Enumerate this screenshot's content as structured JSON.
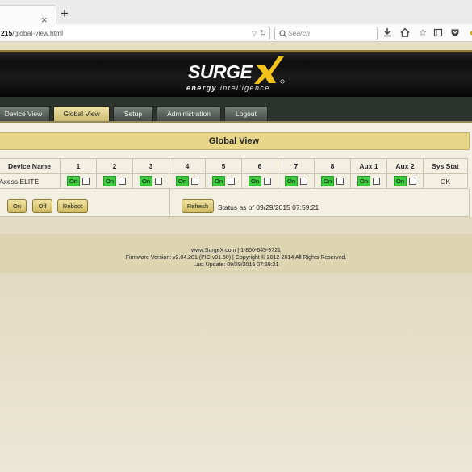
{
  "browser": {
    "url_host": "215",
    "url_path": "/global-view.html",
    "search_placeholder": "Search",
    "new_tab": "+",
    "close_tab": "×"
  },
  "brand": {
    "logo_text": "SURGE",
    "tagline_bold": "energy",
    "tagline_rest": " intelligence"
  },
  "nav": {
    "items": [
      "Device View",
      "Global View",
      "Setup",
      "Administration",
      "Logout"
    ],
    "active": "Global View"
  },
  "page": {
    "title": "Global View"
  },
  "grid": {
    "headers": [
      "Device Name",
      "1",
      "2",
      "3",
      "4",
      "5",
      "6",
      "7",
      "8",
      "Aux 1",
      "Aux 2",
      "Sys Stat"
    ],
    "device_name": "Axess ELITE",
    "outlet_state": "On",
    "sys_stat": "OK"
  },
  "actions": {
    "on": "On",
    "off": "Off",
    "reboot": "Reboot",
    "refresh": "Refresh",
    "status": "Status as of 09/29/2015 07:59:21"
  },
  "footer": {
    "site_link": "www.SurgeX.com",
    "phone": " | 1-800-645-9721",
    "firmware": "Firmware Version:  v2.04.281 (PIC v01.50) | Copyright © 2012-2014 All Rights Reserved.",
    "last_update": "Last Update: 09/29/2015 07:59:21"
  },
  "colors": {
    "accent_gold": "#e8d68a",
    "on_green": "#3dc93d",
    "banner_black": "#0e0e0e"
  }
}
